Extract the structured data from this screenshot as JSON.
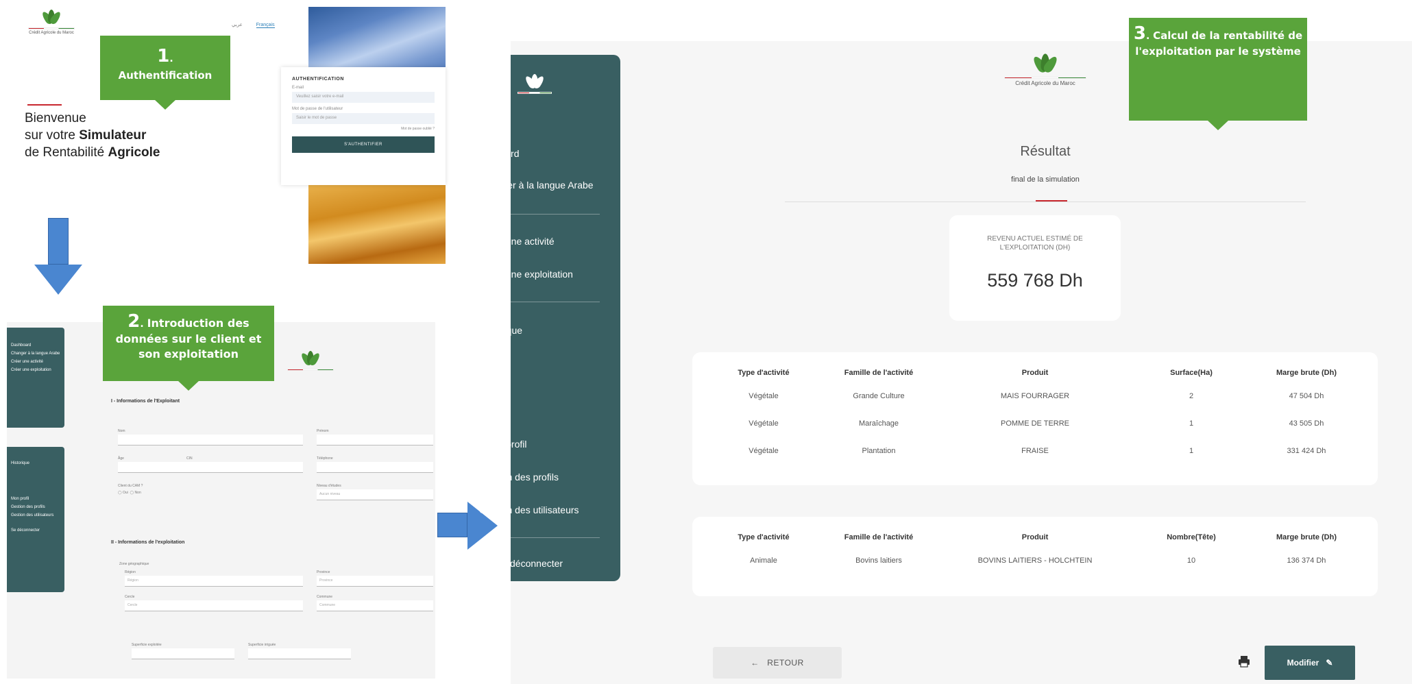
{
  "colors": {
    "primary": "#395f62",
    "callout": "#5aa43b",
    "accent_red": "#c8272e",
    "arrow": "#4a86d0"
  },
  "step1": {
    "callout_number": "1",
    "callout_label": "Authentification",
    "logo": {
      "bank": "Crédit Agricole du Maroc"
    },
    "nav": {
      "lang_ar": "عربي",
      "lang_fr": "Français"
    },
    "welcome": {
      "line1": "Bienvenue",
      "line2_prefix": "sur votre ",
      "line2_bold": "Simulateur",
      "line3_prefix": "de Rentabilité ",
      "line3_bold": "Agricole"
    },
    "login": {
      "title": "AUTHENTIFICATION",
      "email_label": "E-mail",
      "email_placeholder": "Veuillez saisir votre e-mail",
      "password_label": "Mot de passe de l'utilisateur",
      "password_placeholder": "Saisir le mot de passe",
      "forgot": "Mot de passe oublié ?",
      "submit": "S'AUTHENTIFIER"
    }
  },
  "step2": {
    "callout_number": "2",
    "callout_label": "Introduction des données sur le client et son exploitation",
    "sidebar_a": [
      "Dashboard",
      "Changer à la langue Arabe",
      "Créer une activité",
      "Créer une exploitation"
    ],
    "sidebar_b": [
      "Historique",
      "Mon profil",
      "Gestion des profils",
      "Gestion des utilisateurs",
      "Se déconnecter"
    ],
    "section1": "I - Informations de l'Exploitant",
    "section2": "II - Informations de l'exploitation",
    "fields": {
      "nom": "Nom",
      "prenom": "Prénom",
      "age": "Âge",
      "cin": "CIN",
      "telephone": "Téléphone",
      "client": "Client du CAM ?",
      "client_yes": "Oui",
      "client_no": "Non",
      "niveau": "Niveau d'études",
      "niveau_value": "Aucun niveau",
      "zone": "Zone géographique",
      "region": "Région",
      "region_value": "Région",
      "province": "Province",
      "province_value": "Province",
      "cercle": "Cercle",
      "cercle_value": "Cercle",
      "commune": "Commune",
      "commune_value": "Commune",
      "surface_totale": "Superficie exploitée",
      "surface_irriguee": "Superficie irriguée"
    }
  },
  "step3": {
    "callout_number": "3",
    "callout_label": "Calcul de la rentabilité de l'exploitation par le système",
    "logo": {
      "bank": "Crédit Agricole du Maroc"
    },
    "sidebar": {
      "dashboard": "Dashboard",
      "lang": "Changer à la langue Arabe",
      "create_activity": "Créer une activité",
      "create_farm": "Créer une exploitation",
      "history": "Historique",
      "profile": "Mon profil",
      "profiles": "Gestion des profils",
      "users": "Gestion des utilisateurs",
      "logout": "Se déconnecter"
    },
    "title": "Résultat",
    "subtitle": "final de la simulation",
    "kpi": {
      "label": "REVENU ACTUEL ESTIMÉ DE L'EXPLOITATION (DH)",
      "value": "559 768 Dh"
    },
    "vegetal_table": {
      "headers": [
        "Type d'activité",
        "Famille de l'activité",
        "Produit",
        "Surface(Ha)",
        "Marge brute (Dh)"
      ],
      "rows": [
        [
          "Végétale",
          "Grande Culture",
          "MAIS FOURRAGER",
          "2",
          "47 504 Dh"
        ],
        [
          "Végétale",
          "Maraîchage",
          "POMME DE TERRE",
          "1",
          "43 505 Dh"
        ],
        [
          "Végétale",
          "Plantation",
          "FRAISE",
          "1",
          "331 424 Dh"
        ]
      ]
    },
    "animal_table": {
      "headers": [
        "Type d'activité",
        "Famille de l'activité",
        "Produit",
        "Nombre(Tête)",
        "Marge brute (Dh)"
      ],
      "rows": [
        [
          "Animale",
          "Bovins laitiers",
          "BOVINS LAITIERS - HOLCHTEIN",
          "10",
          "136 374 Dh"
        ]
      ]
    },
    "buttons": {
      "back": "RETOUR",
      "edit": "Modifier"
    }
  }
}
